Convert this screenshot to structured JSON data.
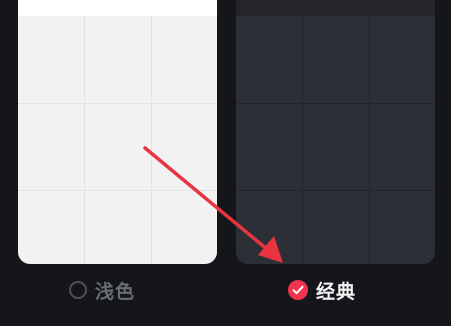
{
  "theme_options": [
    {
      "label": "浅色",
      "selected": false
    },
    {
      "label": "经典",
      "selected": true
    }
  ],
  "icons": {
    "unselected": "radio-empty-icon",
    "selected": "check-circle-icon",
    "pointer": "annotation-arrow-icon"
  },
  "colors": {
    "accent": "#f0344e",
    "arrow": "#e8343f",
    "background": "#14161c"
  }
}
